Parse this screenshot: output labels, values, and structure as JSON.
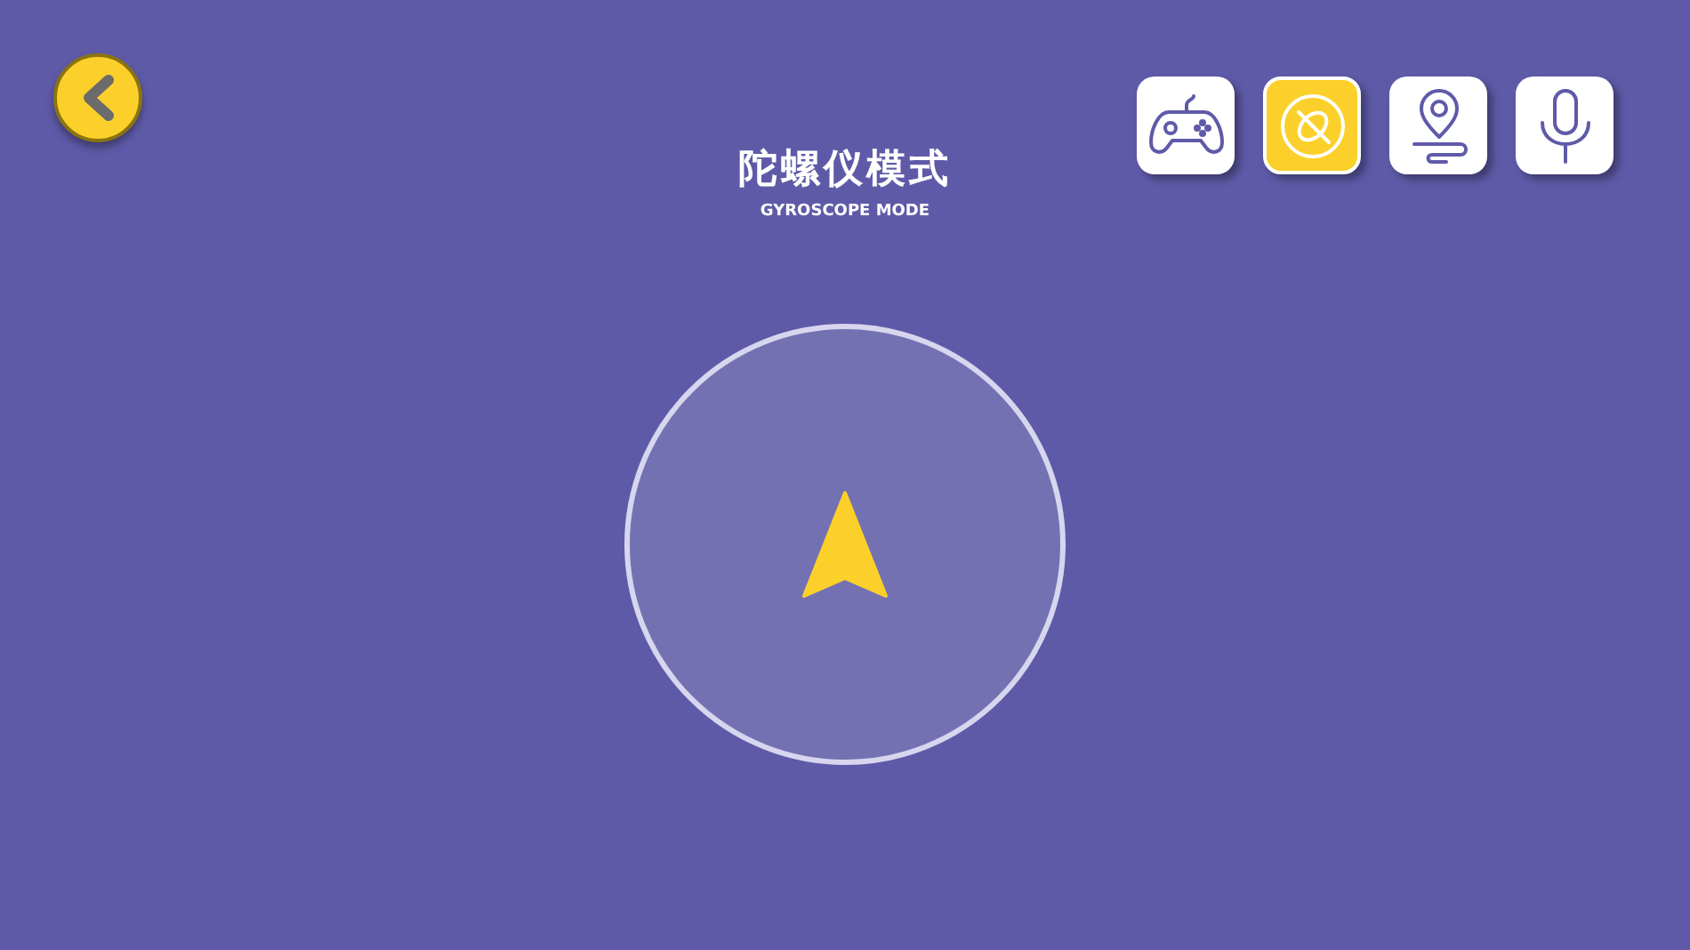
{
  "title": "陀螺仪模式",
  "subtitle": "GYROSCOPE MODE",
  "modes": [
    {
      "kind": "gamepad",
      "selected": false
    },
    {
      "kind": "gyroscope",
      "selected": true
    },
    {
      "kind": "route",
      "selected": false
    },
    {
      "kind": "microphone",
      "selected": false
    }
  ]
}
